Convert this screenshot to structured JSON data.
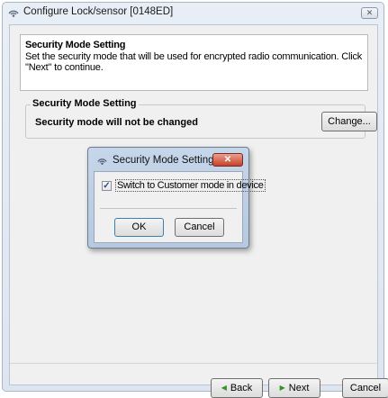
{
  "window": {
    "title": "Configure Lock/sensor [0148ED]",
    "close_symbol": "✕",
    "icon": "radio-signal-icon"
  },
  "header": {
    "title": "Security Mode Setting",
    "description": "Set the security mode that will be used for encrypted radio communication. Click \"Next\" to continue."
  },
  "group": {
    "legend": "Security Mode Setting",
    "status": "Security mode will not be changed",
    "change_label": "Change..."
  },
  "footer": {
    "back_label": "Back",
    "next_label": "Next",
    "cancel_label": "Cancel"
  },
  "dialog": {
    "title": "Security Mode Setting",
    "close_symbol": "✕",
    "checkbox_label": "Switch to Customer mode in device",
    "checkbox_checked": true,
    "ok_label": "OK",
    "cancel_label": "Cancel"
  },
  "colors": {
    "accent": "#3c7fb1",
    "close_red": "#c7412a",
    "arrow_green": "#3a8e2e"
  }
}
